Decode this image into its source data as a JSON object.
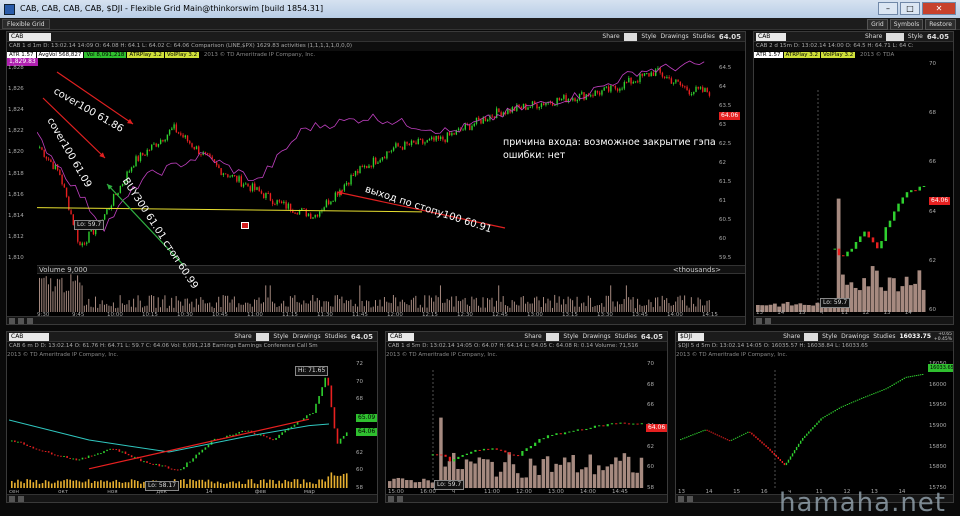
{
  "window": {
    "title": "CAB, CAB, CAB, CAB, $DJI - Flexible Grid Main@thinkorswim [build 1854.31]",
    "buttons": [
      "–",
      "□",
      "✕"
    ]
  },
  "menu": {
    "tab": "Flexible Grid",
    "right": [
      "Grid",
      "Symbols",
      "Restore"
    ]
  },
  "main": {
    "symbol": "CAB",
    "toolbar": {
      "share": "Share",
      "tf": "1m",
      "style": "Style",
      "drawings": "Drawings",
      "studies": "Studies",
      "price": "64.05"
    },
    "info": "CAB 1 d 1m   D: 13:02.14 14:09   O: 64.08   H: 64.1   L: 64.02   C: 64.06   Comparison (LINE,$PX)   1629.83   activities (1,1,1,1,1,0,0,0)",
    "studies": [
      "ATR 1.57",
      "AvgVol 568,827",
      "Vol 8,091,218",
      "ATRPlay 3.2",
      "VolPlay 3.2"
    ],
    "copyright": "2013 © TD Ameritrade IP Company, Inc.",
    "left_box": "1,829.83",
    "left_ticks": [
      "1,828",
      "1,826",
      "1,824",
      "1,822",
      "1,820",
      "1,818",
      "1,816",
      "1,814",
      "1,812",
      "1,810"
    ],
    "right_ticks": [
      "64.5",
      "64",
      "63.5",
      "63",
      "62.5",
      "62",
      "61.5",
      "61",
      "60.5",
      "60",
      "59.5"
    ],
    "right_box": "64.06",
    "time_ticks": [
      "9:30",
      "9:45",
      "10:00",
      "10:15",
      "10:30",
      "10:45",
      "11:00",
      "11:15",
      "11:30",
      "11:45",
      "12:00",
      "12:15",
      "12:30",
      "12:45",
      "13:00",
      "13:15",
      "13:30",
      "13:45",
      "14:00",
      "14:15"
    ],
    "lo_label": "Lo: 59.7",
    "volume_label": "Volume 9,000",
    "volume_unit": "<thousands>",
    "ann1": "cover100 61.86",
    "ann2": "cover100 61.09",
    "ann3": "BUY300 61.01 стоп 60.99",
    "ann4": "выход по стопу100 60.91",
    "reason1": "причина входа: возможное закрытие гэпа",
    "reason2": "ошибки: нет"
  },
  "tr": {
    "symbol": "CAB",
    "toolbar": {
      "share": "Share",
      "tf": "15m",
      "style": "Style",
      "drawings": "Drawings",
      "price": "64.05"
    },
    "info": "CAB 2 d 15m  D: 13:02.14 14:00  O: 64.5  H: 64.71  L: 64  C:",
    "studies": [
      "ATR 1.57",
      "ATRPlay 3.2",
      "VolPlay 3.2"
    ],
    "copyright": "2013 © TDA",
    "right_ticks": [
      "70",
      "68",
      "66",
      "64",
      "62",
      "60"
    ],
    "right_box": "64.06",
    "lo_label": "Lo: 59.7",
    "time_ticks": [
      "13",
      "14",
      "15",
      "ч",
      "11",
      "12",
      "13",
      "14"
    ]
  },
  "bl": {
    "symbol": "CAB",
    "toolbar": {
      "share": "Share",
      "tf": "1m",
      "style": "Style",
      "drawings": "Drawings",
      "studies": "Studies",
      "price": "64.05"
    },
    "info": "CAB 6 m D   D: 13:02.14   O: 61.76   H: 64.71   L: 59.7   C: 64.06   Vol: 8,091,218   Earnings   Earnings Conference Call   Sm",
    "copyright": "2013 © TD Ameritrade IP Company, Inc.",
    "hi_label": "Hi: 71.65",
    "lo_label": "Lo: 58.17",
    "right_ticks": [
      "72",
      "70",
      "68",
      "66",
      "64",
      "62",
      "60",
      "58"
    ],
    "right_box1": "65.09",
    "right_box2": "64.06",
    "time_ticks": [
      "сен",
      "окт",
      "ноя",
      "дек",
      "14",
      "фев",
      "мар"
    ]
  },
  "bm": {
    "symbol": "CAB",
    "toolbar": {
      "share": "Share",
      "tf": "5m",
      "style": "Style",
      "drawings": "Drawings",
      "studies": "Studies",
      "price": "64.05"
    },
    "info": "CAB 1 d 5m   D: 13:02.14 14:05   O: 64.07   H: 64.14   L: 64.05   C: 64.08   R: 0.14   Volume: 71,516",
    "copyright": "2013 © TD Ameritrade IP Company, Inc.",
    "lo_label": "Lo: 59.7",
    "right_ticks": [
      "70",
      "68",
      "66",
      "64",
      "62",
      "60",
      "58"
    ],
    "right_box": "64.06",
    "time_ticks": [
      "15:00",
      "16:00",
      "ч",
      "11:00",
      "12:00",
      "13:00",
      "14:00",
      "14:45"
    ]
  },
  "br": {
    "symbol": "$DJI",
    "toolbar": {
      "share": "Share",
      "tf": "5m",
      "style": "Style",
      "drawings": "Drawings",
      "studies": "Studies",
      "price": "16033.75"
    },
    "price_change": "+0.65",
    "price_pct": "+0.45%",
    "info": "$DJI 5 d 5m   D: 13:02.14 14:05   O: 16035.57   H: 16038.84   L: 16033.65",
    "copyright": "2013 © TD Ameritrade IP Company, Inc.",
    "right_ticks": [
      "16050",
      "16000",
      "15950",
      "15900",
      "15850",
      "15800",
      "15750"
    ],
    "right_box": "16033.65",
    "time_ticks": [
      "13",
      "14",
      "15",
      "16",
      "ч",
      "11",
      "12",
      "13",
      "14"
    ]
  },
  "watermark": "hamaha.net",
  "colors": {
    "up": "#2fd02f",
    "down": "#e82020",
    "compare": "#c040c0",
    "volume": "#a68a80",
    "annot_arrow": "#e02020",
    "buy_arrow": "#30b040"
  }
}
